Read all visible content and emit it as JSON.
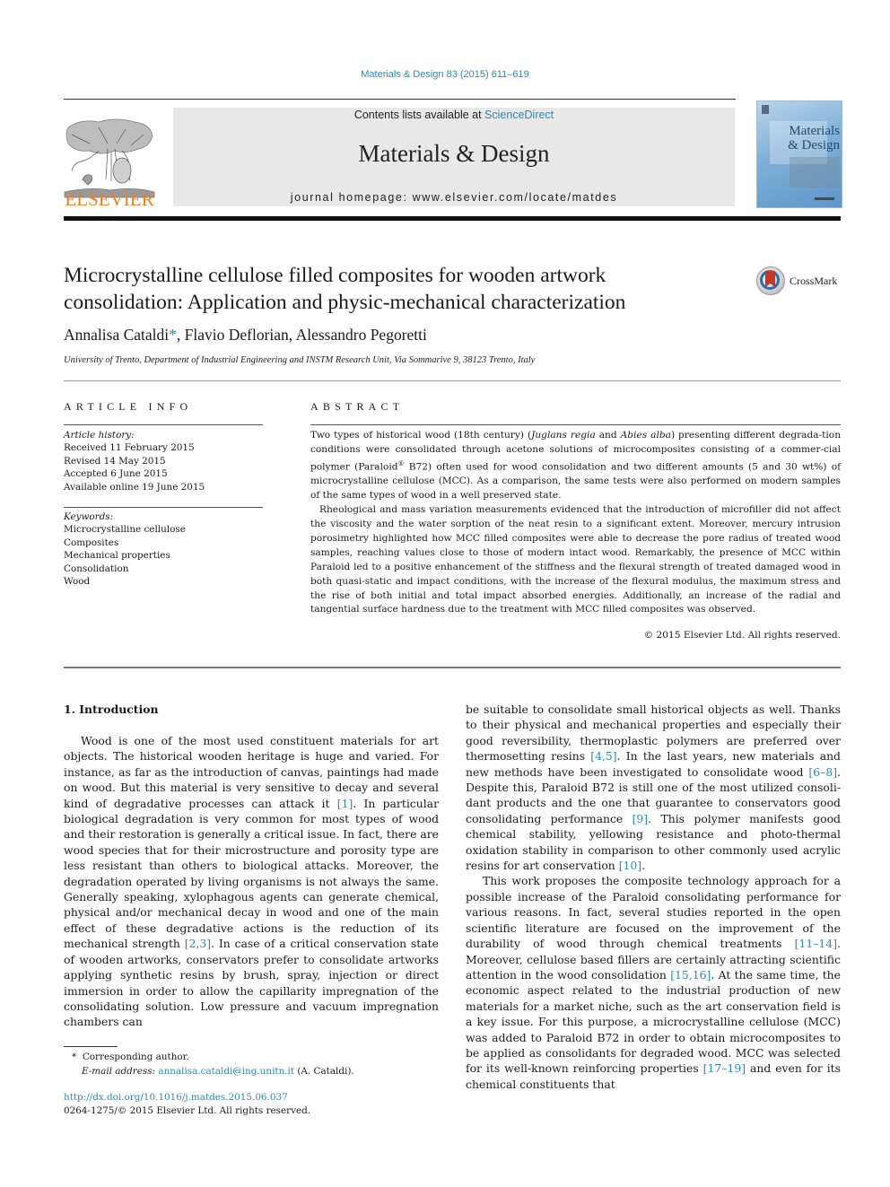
{
  "header": {
    "citation": "Materials & Design 83 (2015) 611–619",
    "contents_prefix": "Contents lists available at ",
    "contents_link": "ScienceDirect",
    "journal_title": "Materials & Design",
    "homepage_prefix": "journal homepage: ",
    "homepage_url": "www.elsevier.com/locate/matdes",
    "publisher_logo_text": "ELSEVIER",
    "cover_title_line1": "Materials",
    "cover_title_line2": "& Design",
    "colors": {
      "link": "#2a8ab8",
      "elsevier_orange": "#f07f1e",
      "masthead_bg": "#e8e8e8"
    }
  },
  "article": {
    "title": "Microcrystalline cellulose filled composites for wooden artwork consolidation: Application and physic-mechanical characterization",
    "crossmark_label": "CrossMark",
    "authors": [
      {
        "name": "Annalisa Cataldi",
        "mark": "*",
        "sep": ", "
      },
      {
        "name": "Flavio Deflorian",
        "mark": "",
        "sep": ", "
      },
      {
        "name": "Alessandro Pegoretti",
        "mark": "",
        "sep": ""
      }
    ],
    "affiliation": "University of Trento, Department of Industrial Engineering and INSTM Research Unit, Via Sommarive 9, 38123 Trento, Italy"
  },
  "article_info": {
    "heading": "ARTICLE INFO",
    "history_label": "Article history:",
    "history": [
      "Received 11 February 2015",
      "Revised 14 May 2015",
      "Accepted 6 June 2015",
      "Available online 19 June 2015"
    ],
    "keywords_label": "Keywords:",
    "keywords": [
      "Microcrystalline cellulose",
      "Composites",
      "Mechanical properties",
      "Consolidation",
      "Wood"
    ]
  },
  "abstract": {
    "heading": "ABSTRACT",
    "p1": {
      "a": "Two types of historical wood (18th century) (",
      "species1": "Juglans regia",
      "b": " and ",
      "species2": "Abies alba",
      "c": ") presenting different degrada-tion conditions were consolidated through acetone solutions of microcomposites consisting of a commer-cial polymer (Paraloid",
      "reg": "®",
      "d": " B72) often used for wood consolidation and two different amounts (5 and 30 wt%) of microcrystalline cellulose (MCC). As a comparison, the same tests were also performed on modern samples of the same types of wood in a well preserved state."
    },
    "p2": "Rheological and mass variation measurements evidenced that the introduction of microfiller did not affect the viscosity and the water sorption of the neat resin to a significant extent. Moreover, mercury intrusion porosimetry highlighted how MCC filled composites were able to decrease the pore radius of treated wood samples, reaching values close to those of modern intact wood. Remarkably, the presence of MCC within Paraloid led to a positive enhancement of the stiffness and the flexural strength of treated damaged wood in both quasi-static and impact conditions, with the increase of the flexural modulus, the maximum stress and the rise of both initial and total impact absorbed energies. Additionally, an increase of the radial and tangential surface hardness due to the treatment with MCC filled composites was observed.",
    "copyright": "© 2015 Elsevier Ltd. All rights reserved."
  },
  "body": {
    "intro_heading": "1. Introduction",
    "left_p1": [
      {
        "t": "Wood is one of the most used constituent materials for art objects. The historical wooden heritage is huge and varied. For instance, as far as the introduction of canvas, paintings had made on wood. But this material is very sensitive to decay and several kind of degradative processes can attack it "
      },
      {
        "ref": "[1]"
      },
      {
        "t": ". In particular biolog­ical degradation is very common for most types of wood and their restoration is generally a critical issue. In fact, there are wood spe­cies that for their microstructure and porosity type are less resis­tant than others to biological attacks. Moreover, the degradation operated by living organisms is not always the same. Generally speaking, xylophagous agents can generate chemical, physical and/or mechanical decay in wood and one of the main effect of these degradative actions is the reduction of its mechanical strength "
      },
      {
        "ref": "[2,3]"
      },
      {
        "t": ". In case of a critical conservation state of wooden art­works, conservators prefer to consolidate artworks applying syn­thetic resins by brush, spray, injection or direct immersion in order to allow the capillarity impregnation of the consolidating solution. Low pressure and vacuum impregnation chambers can"
      }
    ],
    "right_p1": [
      {
        "t": "be suitable to consolidate small historical objects as well. Thanks to their physical and mechanical properties and especially their good reversibility, thermoplastic polymers are preferred over ther­mosetting resins "
      },
      {
        "ref": "[4,5]"
      },
      {
        "t": ". In the last years, new materials and new methods have been investigated to consolidate wood "
      },
      {
        "ref": "[6–8]"
      },
      {
        "t": ". Despite this, Paraloid B72 is still one of the most utilized consoli­dant products and the one that guarantee to conservators good consolidating performance "
      },
      {
        "ref": "[9]"
      },
      {
        "t": ". This polymer manifests good chem­ical stability, yellowing resistance and photo-thermal oxidation stability in comparison to other commonly used acrylic resins for art conservation "
      },
      {
        "ref": "[10]"
      },
      {
        "t": "."
      }
    ],
    "right_p2": [
      {
        "t": "This work proposes the composite technology approach for a possible increase of the Paraloid consolidating performance for various reasons. In fact, several studies reported in the open scien­tific literature are focused on the improvement of the durability of wood through chemical treatments "
      },
      {
        "ref": "[11–14]"
      },
      {
        "t": ". Moreover, cellulose based fillers are certainly attracting scientific attention in the wood consolidation "
      },
      {
        "ref": "[15,16]"
      },
      {
        "t": ". At the same time, the economic aspect related to the industrial production of new materials for a market niche, such as the art conservation field is a key issue. For this pur­pose, a microcrystalline cellulose (MCC) was added to Paraloid B72 in order to obtain microcomposites to be applied as consolidants for degraded wood. MCC was selected for its well-known reinforc­ing properties "
      },
      {
        "ref": "[17–19]"
      },
      {
        "t": " and even for its chemical constituents that"
      }
    ]
  },
  "footnotes": {
    "star": "*",
    "corresponding": "Corresponding author.",
    "email_label": "E-mail address:",
    "email": "annalisa.cataldi@ing.unitn.it",
    "email_suffix": " (A. Cataldi).",
    "doi": "http://dx.doi.org/10.1016/j.matdes.2015.06.037",
    "issn_line": "0264-1275/© 2015 Elsevier Ltd. All rights reserved."
  }
}
